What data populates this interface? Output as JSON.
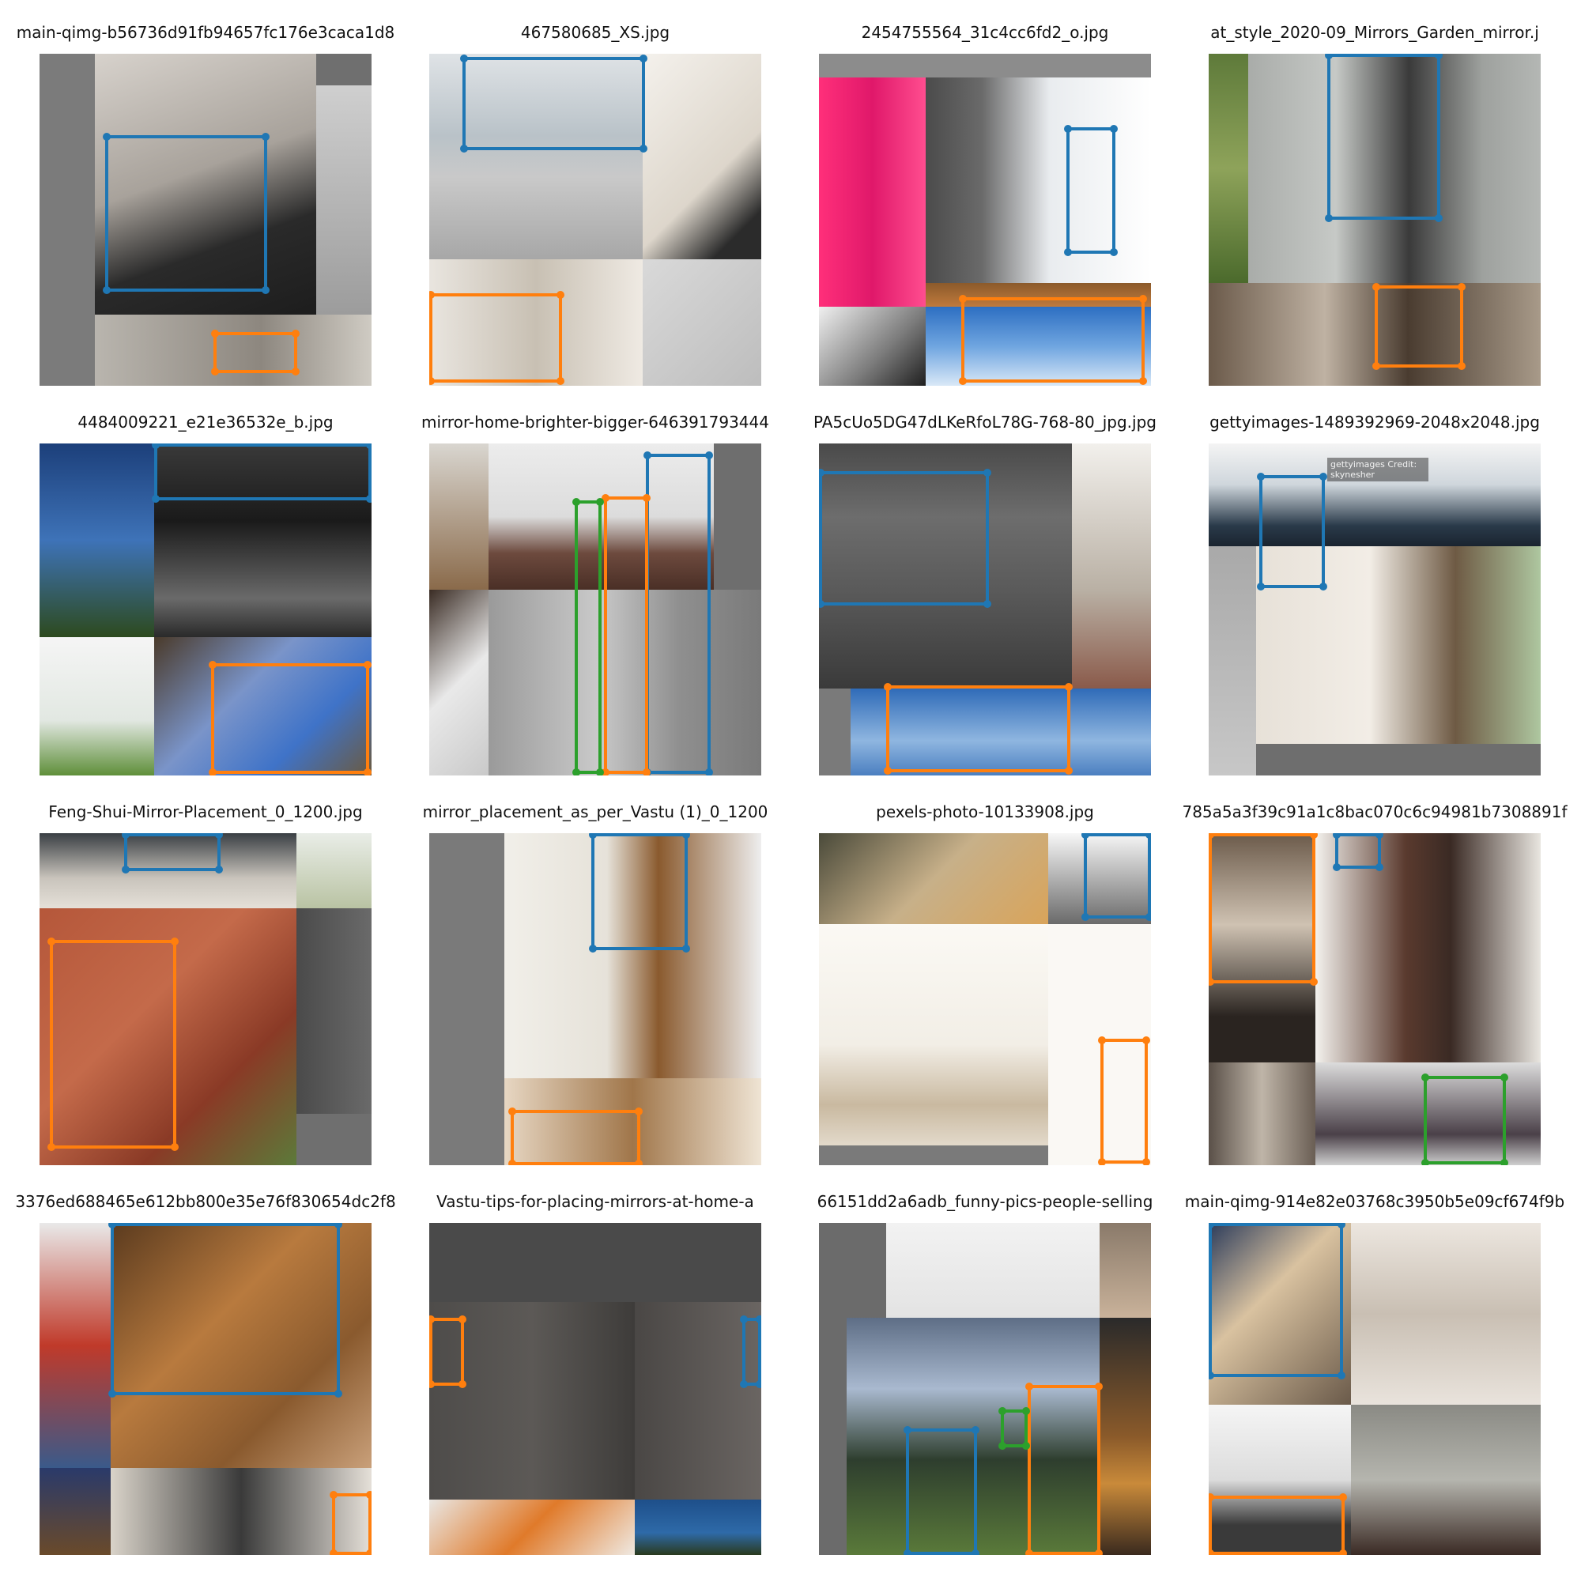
{
  "figure": {
    "panels": [
      {
        "title": "main-qimg-b56736d91fb94657fc176e3caca1d8",
        "boxes": [
          "blue",
          "orange"
        ]
      },
      {
        "title": "467580685_XS.jpg",
        "boxes": [
          "blue",
          "orange"
        ]
      },
      {
        "title": "2454755564_31c4cc6fd2_o.jpg",
        "boxes": [
          "blue",
          "orange"
        ]
      },
      {
        "title": "at_style_2020-09_Mirrors_Garden_mirror.j",
        "boxes": [
          "blue",
          "orange"
        ]
      },
      {
        "title": "4484009221_e21e36532e_b.jpg",
        "boxes": [
          "blue",
          "orange"
        ]
      },
      {
        "title": "mirror-home-brighter-bigger-646391793444",
        "boxes": [
          "blue",
          "orange",
          "green"
        ]
      },
      {
        "title": "PA5cUo5DG47dLKeRfoL78G-768-80_jpg.jpg",
        "boxes": [
          "blue",
          "orange"
        ]
      },
      {
        "title": "gettyimages-1489392969-2048x2048.jpg",
        "boxes": [
          "blue"
        ],
        "watermark": "gettyimages Credit: skynesher"
      },
      {
        "title": "Feng-Shui-Mirror-Placement_0_1200.jpg",
        "boxes": [
          "blue",
          "orange"
        ]
      },
      {
        "title": "mirror_placement_as_per_Vastu (1)_0_1200",
        "boxes": [
          "blue",
          "orange"
        ]
      },
      {
        "title": "pexels-photo-10133908.jpg",
        "boxes": [
          "blue",
          "orange"
        ]
      },
      {
        "title": "785a5a3f39c91a1c8bac070c6c94981b7308891f",
        "boxes": [
          "orange",
          "blue",
          "green"
        ]
      },
      {
        "title": "3376ed688465e612bb800e35e76f830654dc2f8",
        "boxes": [
          "blue",
          "orange"
        ]
      },
      {
        "title": "Vastu-tips-for-placing-mirrors-at-home-a",
        "boxes": [
          "orange",
          "blue"
        ]
      },
      {
        "title": "66151dd2a6adb_funny-pics-people-selling",
        "boxes": [
          "blue",
          "orange",
          "green"
        ]
      },
      {
        "title": "main-qimg-914e82e03768c3950b5e09cf674f9b",
        "boxes": [
          "blue",
          "orange"
        ]
      }
    ]
  },
  "colors": {
    "blue": "#1f77b4",
    "orange": "#ff7f0e",
    "green": "#2ca02c"
  }
}
